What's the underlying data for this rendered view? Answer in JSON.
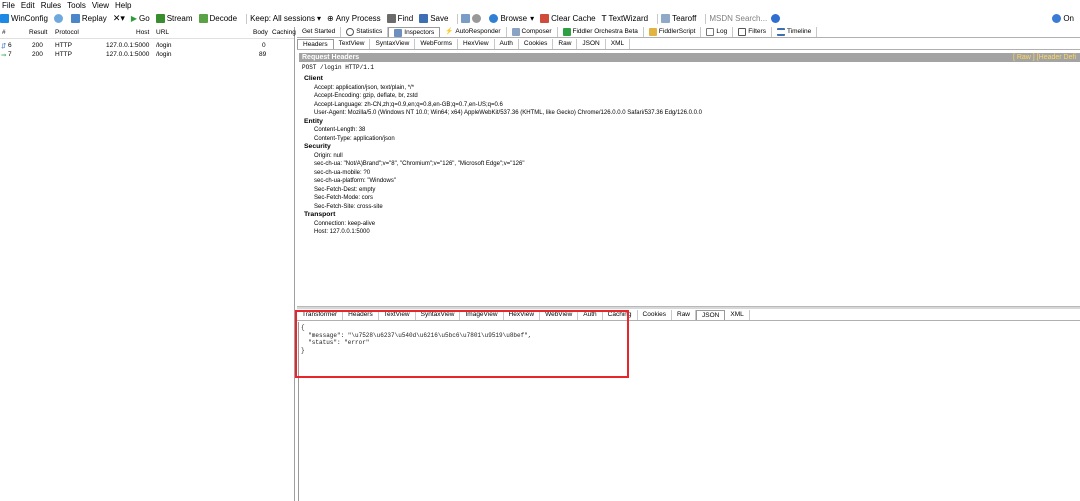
{
  "menu": [
    "File",
    "Edit",
    "Rules",
    "Tools",
    "View",
    "Help"
  ],
  "toolbar": {
    "winconfig": "WinConfig",
    "replay": "Replay",
    "go": "Go",
    "stream": "Stream",
    "decode": "Decode",
    "keep": "Keep: All sessions",
    "any_process": "Any Process",
    "find": "Find",
    "save": "Save",
    "browse": "Browse",
    "clear_cache": "Clear Cache",
    "textwizard": "TextWizard",
    "tearoff": "Tearoff",
    "msdn_search": "MSDN Search...",
    "online": "On"
  },
  "sessions": {
    "columns": [
      "#",
      "Result",
      "Protocol",
      "Host",
      "URL",
      "Body",
      "Caching"
    ],
    "rows": [
      {
        "num": "6",
        "result": "200",
        "protocol": "HTTP",
        "host": "127.0.0.1:5000",
        "url": "/login",
        "body": "0"
      },
      {
        "num": "7",
        "result": "200",
        "protocol": "HTTP",
        "host": "127.0.0.1:5000",
        "url": "/login",
        "body": "89"
      }
    ]
  },
  "inspector_tabs": {
    "get_started": "Get Started",
    "statistics": "Statistics",
    "inspectors": "Inspectors",
    "autoresponder": "AutoResponder",
    "composer": "Composer",
    "orchestra": "Fiddler Orchestra Beta",
    "fiddlerscript": "FiddlerScript",
    "log": "Log",
    "filters": "Filters",
    "timeline": "Timeline"
  },
  "request_tabs": [
    "Headers",
    "TextView",
    "SyntaxView",
    "WebForms",
    "HexView",
    "Auth",
    "Cookies",
    "Raw",
    "JSON",
    "XML"
  ],
  "request": {
    "title": "Request Headers",
    "title_right": "[ Raw ]   [Header Defi",
    "line": "POST /login HTTP/1.1",
    "groups": [
      {
        "name": "Client",
        "headers": [
          "Accept: application/json, text/plain, */*",
          "Accept-Encoding: gzip, deflate, br, zstd",
          "Accept-Language: zh-CN,zh;q=0.9,en;q=0.8,en-GB;q=0.7,en-US;q=0.6",
          "User-Agent: Mozilla/5.0 (Windows NT 10.0; Win64; x64) AppleWebKit/537.36 (KHTML, like Gecko) Chrome/126.0.0.0 Safari/537.36 Edg/126.0.0.0"
        ]
      },
      {
        "name": "Entity",
        "headers": [
          "Content-Length: 38",
          "Content-Type: application/json"
        ]
      },
      {
        "name": "Security",
        "headers": [
          "Origin: null",
          "sec-ch-ua: \"Not/A)Brand\";v=\"8\", \"Chromium\";v=\"126\", \"Microsoft Edge\";v=\"126\"",
          "sec-ch-ua-mobile: ?0",
          "sec-ch-ua-platform: \"Windows\"",
          "Sec-Fetch-Dest: empty",
          "Sec-Fetch-Mode: cors",
          "Sec-Fetch-Site: cross-site"
        ]
      },
      {
        "name": "Transport",
        "headers": [
          "Connection: keep-alive",
          "Host: 127.0.0.1:5000"
        ]
      }
    ]
  },
  "response_tabs": [
    "Transformer",
    "Headers",
    "TextView",
    "SyntaxView",
    "ImageView",
    "HexView",
    "WebView",
    "Auth",
    "Caching",
    "Cookies",
    "Raw",
    "JSON",
    "XML"
  ],
  "response": {
    "body": "{\n  \"message\": \"\\u7528\\u6237\\u540d\\u6216\\u5bc6\\u7801\\u9519\\u8bef\",\n  \"status\": \"error\"\n}"
  },
  "colors": {
    "highlight": "#e8252b",
    "header_bar": "#a3a3a3",
    "raw_link": "#ffd85a"
  }
}
